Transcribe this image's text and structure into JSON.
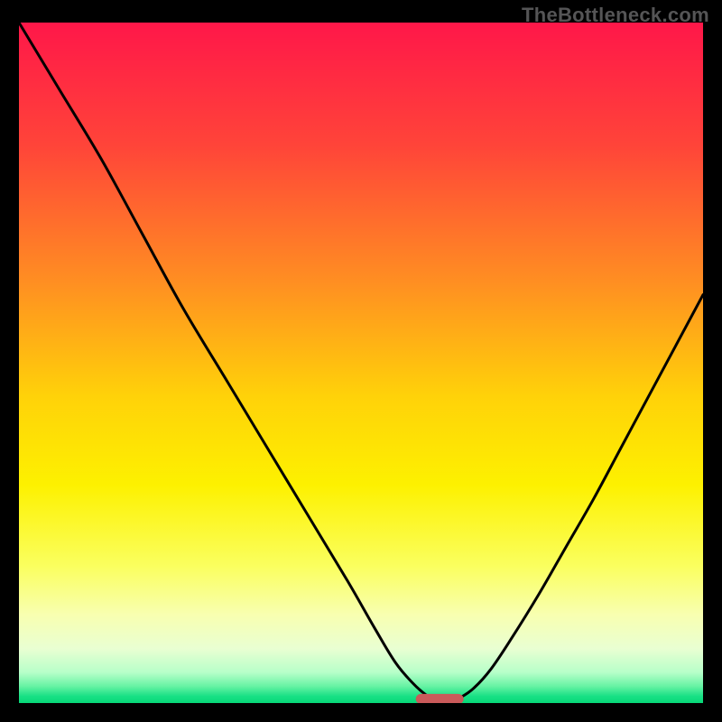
{
  "watermark": "TheBottleneck.com",
  "colors": {
    "frame": "#000000",
    "curve": "#000000",
    "marker": "#c95a5a",
    "gradient_stops": [
      {
        "offset": 0.0,
        "color": "#ff1749"
      },
      {
        "offset": 0.18,
        "color": "#ff4439"
      },
      {
        "offset": 0.38,
        "color": "#ff8e22"
      },
      {
        "offset": 0.55,
        "color": "#ffd209"
      },
      {
        "offset": 0.68,
        "color": "#fdf100"
      },
      {
        "offset": 0.8,
        "color": "#faff60"
      },
      {
        "offset": 0.87,
        "color": "#f8ffb0"
      },
      {
        "offset": 0.92,
        "color": "#e9ffd2"
      },
      {
        "offset": 0.955,
        "color": "#b7ffc9"
      },
      {
        "offset": 0.975,
        "color": "#68f3a4"
      },
      {
        "offset": 0.99,
        "color": "#18e085"
      },
      {
        "offset": 1.0,
        "color": "#07d878"
      }
    ]
  },
  "chart_data": {
    "type": "line",
    "title": "",
    "xlabel": "",
    "ylabel": "",
    "xlim": [
      0,
      100
    ],
    "ylim": [
      0,
      100
    ],
    "x": [
      0,
      6,
      12,
      18,
      24,
      30,
      36,
      42,
      48,
      52,
      55,
      57.5,
      59.5,
      61,
      62,
      63,
      64.5,
      66.5,
      69,
      72,
      76,
      80,
      84,
      88,
      92,
      96,
      100
    ],
    "values": [
      100,
      90,
      80,
      69,
      58,
      48,
      38,
      28,
      18,
      11,
      6,
      3,
      1.2,
      0.4,
      0.2,
      0.25,
      0.8,
      2.2,
      5,
      9.5,
      16,
      23,
      30,
      37.5,
      45,
      52.5,
      60
    ],
    "marker": {
      "x_center": 61.5,
      "y": 0.6,
      "width": 7,
      "height": 1.5
    },
    "annotations": []
  }
}
